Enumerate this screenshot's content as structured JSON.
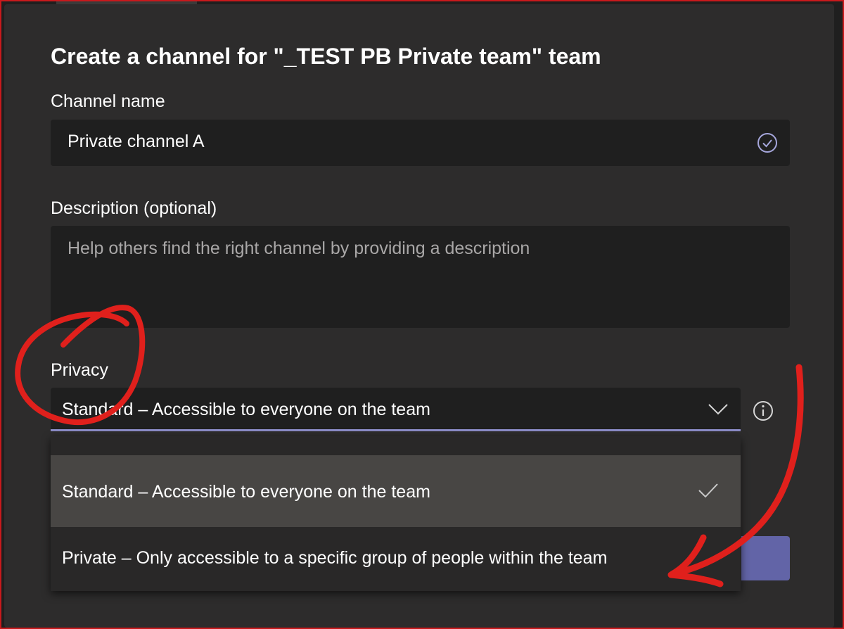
{
  "dialog": {
    "title": "Create a channel for \"_TEST PB Private team\" team"
  },
  "channel_name": {
    "label": "Channel name",
    "value": "Private channel A",
    "valid_icon": "check-circle-icon"
  },
  "description": {
    "label": "Description (optional)",
    "placeholder": "Help others find the right channel by providing a description"
  },
  "privacy": {
    "label": "Privacy",
    "selected": "Standard – Accessible to everyone on the team",
    "info_icon": "info-icon",
    "options": [
      {
        "label": "Standard – Accessible to everyone on the team",
        "selected": true
      },
      {
        "label": "Private – Only accessible to a specific group of people within the team",
        "selected": false
      }
    ]
  },
  "colors": {
    "dialog_bg": "#2d2c2c",
    "input_bg": "#1f1f1f",
    "accent": "#6264a7",
    "focus_underline": "#8b8cc7",
    "annotation_red": "#e0201c"
  }
}
